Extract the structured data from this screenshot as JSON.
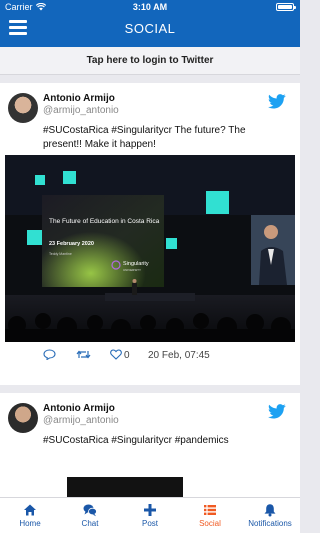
{
  "status_bar": {
    "carrier": "Carrier",
    "time": "3:10 AM"
  },
  "header": {
    "title": "SOCIAL",
    "menu_icon": "hamburger-menu-icon"
  },
  "login_bar": {
    "label": "Tap here to login to Twitter"
  },
  "tweets": [
    {
      "name": "Antonio Armijo",
      "handle": "@armijo_antonio",
      "text": "#SUCostaRica #Singularitycr The future? The present!! Make it happen!",
      "like_count": "0",
      "date": "20 Feb, 07:45",
      "image": {
        "screen_title": "The Future of Education in Costa Rica",
        "screen_date": "23 February 2020",
        "screen_speaker": "Teddy Mantine",
        "brand": "Singularity",
        "brand_sub": "UNIVERSITY"
      }
    },
    {
      "name": "Antonio Armijo",
      "handle": "@armijo_antonio",
      "text": "#SUCostaRica #Singularitycr #pandemics"
    }
  ],
  "tabs": [
    {
      "label": "Home",
      "icon": "home-icon"
    },
    {
      "label": "Chat",
      "icon": "chat-bubbles-icon"
    },
    {
      "label": "Post",
      "icon": "plus-icon"
    },
    {
      "label": "Social",
      "icon": "list-icon",
      "active": true
    },
    {
      "label": "Notifications",
      "icon": "bell-icon"
    }
  ],
  "colors": {
    "header": "#1266bc",
    "accent_active": "#f05a22",
    "tab_label": "#1a57a8",
    "twitter": "#1da1f2"
  }
}
